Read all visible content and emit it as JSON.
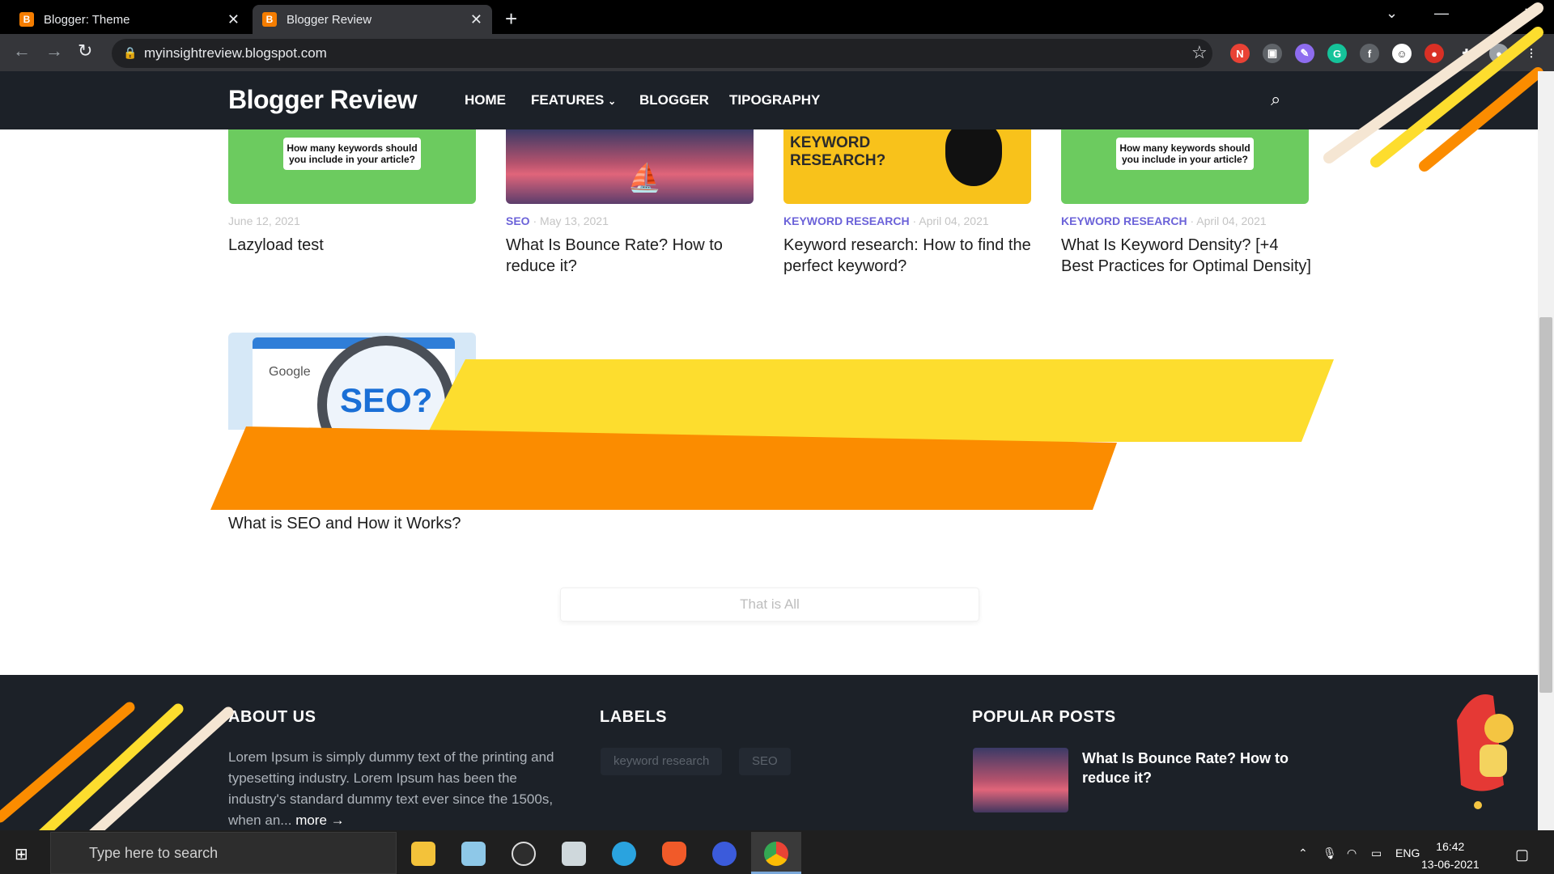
{
  "browser": {
    "tabs": [
      {
        "title": "Blogger: Theme",
        "active": false
      },
      {
        "title": "Blogger Review",
        "active": true
      }
    ],
    "url": "myinsightreview.blogspot.com"
  },
  "blog": {
    "title": "Blogger Review",
    "nav": [
      "HOME",
      "FEATURES",
      "BLOGGER",
      "TIPOGRAPHY"
    ]
  },
  "posts": [
    {
      "label": "",
      "date": "June 12, 2021",
      "title": "Lazyload test",
      "thumb_text": "How many keywords should you include in your article?"
    },
    {
      "label": "SEO",
      "date": "May 13, 2021",
      "title": "What Is Bounce Rate? How to reduce it?"
    },
    {
      "label": "KEYWORD RESEARCH",
      "date": "April 04, 2021",
      "title": "Keyword research: How to find the perfect keyword?",
      "thumb_text": "KEYWORD RESEARCH?"
    },
    {
      "label": "KEYWORD RESEARCH",
      "date": "April 04, 2021",
      "title": "What Is Keyword Density? [+4 Best Practices for Optimal Density]",
      "thumb_text": "How many keywords should you include in your article?"
    }
  ],
  "featured": {
    "title": "What is SEO and How it Works?",
    "thumb_google": "Google",
    "thumb_seo": "SEO?"
  },
  "load_more": "That is All",
  "footer": {
    "about_heading": "ABOUT US",
    "about_text": "Lorem Ipsum is simply dummy text of the printing and typesetting industry. Lorem Ipsum has been the industry's standard dummy text ever since the 1500s, when an...",
    "more": "more →",
    "labels_heading": "LABELS",
    "labels": [
      "keyword research",
      "SEO"
    ],
    "popular_heading": "POPULAR POSTS",
    "popular_title": "What Is Bounce Rate? How to reduce it?"
  },
  "taskbar": {
    "search_placeholder": "Type here to search",
    "lang": "ENG",
    "time": "16:42",
    "date": "13-06-2021"
  },
  "colors": {
    "accent_label": "#6c63d9",
    "header_bg": "#1c2128",
    "overlay_yellow": "#fddd2e",
    "overlay_orange": "#fb8c00"
  }
}
